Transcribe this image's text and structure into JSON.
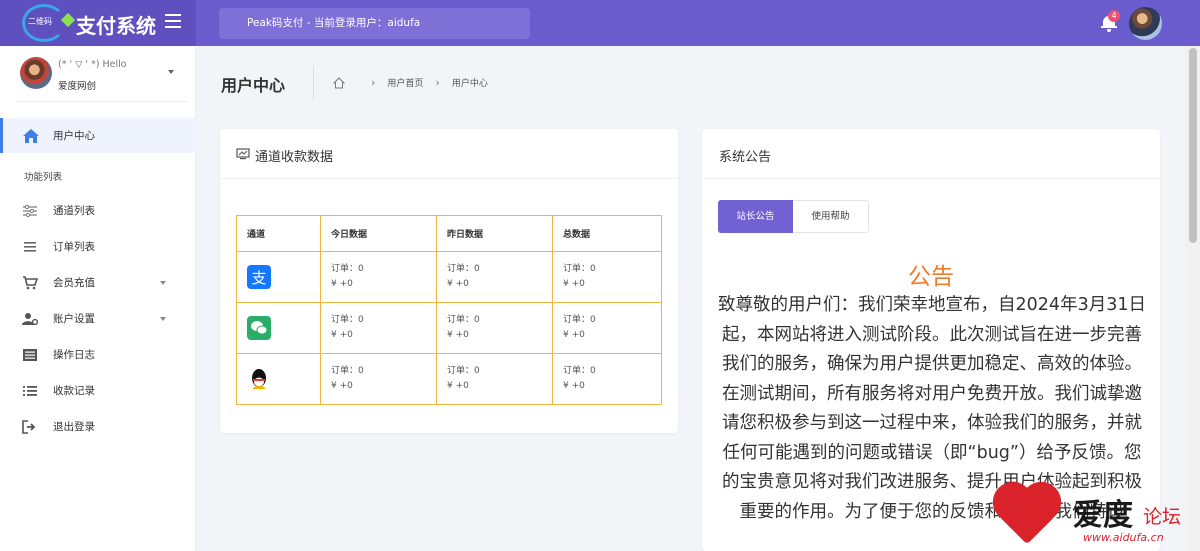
{
  "topbar": {
    "logo_small": "二维码",
    "logo_text": "支付系统",
    "notice": "Peak码支付 - 当前登录用户：aidufa",
    "notification_count": "4"
  },
  "user": {
    "hello": "(* ' ▽ ' *) Hello",
    "name": "爱度网创"
  },
  "sidebar": {
    "active": "用户中心",
    "section": "功能列表",
    "items": [
      {
        "label": "通道列表",
        "icon": "sliders-icon"
      },
      {
        "label": "订单列表",
        "icon": "menu-icon"
      },
      {
        "label": "会员充值",
        "icon": "cart-icon",
        "expandable": true
      },
      {
        "label": "账户设置",
        "icon": "user-gear-icon",
        "expandable": true
      },
      {
        "label": "操作日志",
        "icon": "list-box-icon"
      },
      {
        "label": "收款记录",
        "icon": "list-icon"
      },
      {
        "label": "退出登录",
        "icon": "logout-icon"
      }
    ]
  },
  "page": {
    "title": "用户中心",
    "breadcrumb": [
      "用户首页",
      "用户中心"
    ]
  },
  "channel_card": {
    "title": "通道收款数据",
    "headers": [
      "通道",
      "今日数据",
      "昨日数据",
      "总数据"
    ],
    "rows": [
      {
        "channel": "alipay",
        "cells": [
          [
            "订单：0",
            "¥ +0"
          ],
          [
            "订单：0",
            "¥ +0"
          ],
          [
            "订单：0",
            "¥ +0"
          ]
        ]
      },
      {
        "channel": "wechat",
        "cells": [
          [
            "订单：0",
            "¥ +0"
          ],
          [
            "订单：0",
            "¥ +0"
          ],
          [
            "订单：0",
            "¥ +0"
          ]
        ]
      },
      {
        "channel": "qq",
        "cells": [
          [
            "订单：0",
            "¥ +0"
          ],
          [
            "订单：0",
            "¥ +0"
          ],
          [
            "订单：0",
            "¥ +0"
          ]
        ]
      }
    ]
  },
  "announce_card": {
    "title": "系统公告",
    "tab_active": "站长公告",
    "tab_other": "使用帮助",
    "heading": "公告",
    "body": "致尊敬的用户们：我们荣幸地宣布，自2024年3月31日起，本网站将进入测试阶段。此次测试旨在进一步完善我们的服务，确保为用户提供更加稳定、高效的体验。在测试期间，所有服务将对用户免费开放。我们诚挚邀请您积极参与到这一过程中来，体验我们的服务，并就任何可能遇到的问题或错误（即“bug”）给予反馈。您的宝贵意见将对我们改进服务、提升用户体验起到积极重要的作用。为了便于您的反馈和交流，我们特设"
  },
  "watermark": {
    "brand": "爱度",
    "suffix": "论坛",
    "url": "www.aidufa.cn"
  },
  "colors": {
    "topbar": "#6a5ccc",
    "accent": "#7261d2",
    "table_border": "#f2b540",
    "notice_heading": "#f07c2c"
  }
}
